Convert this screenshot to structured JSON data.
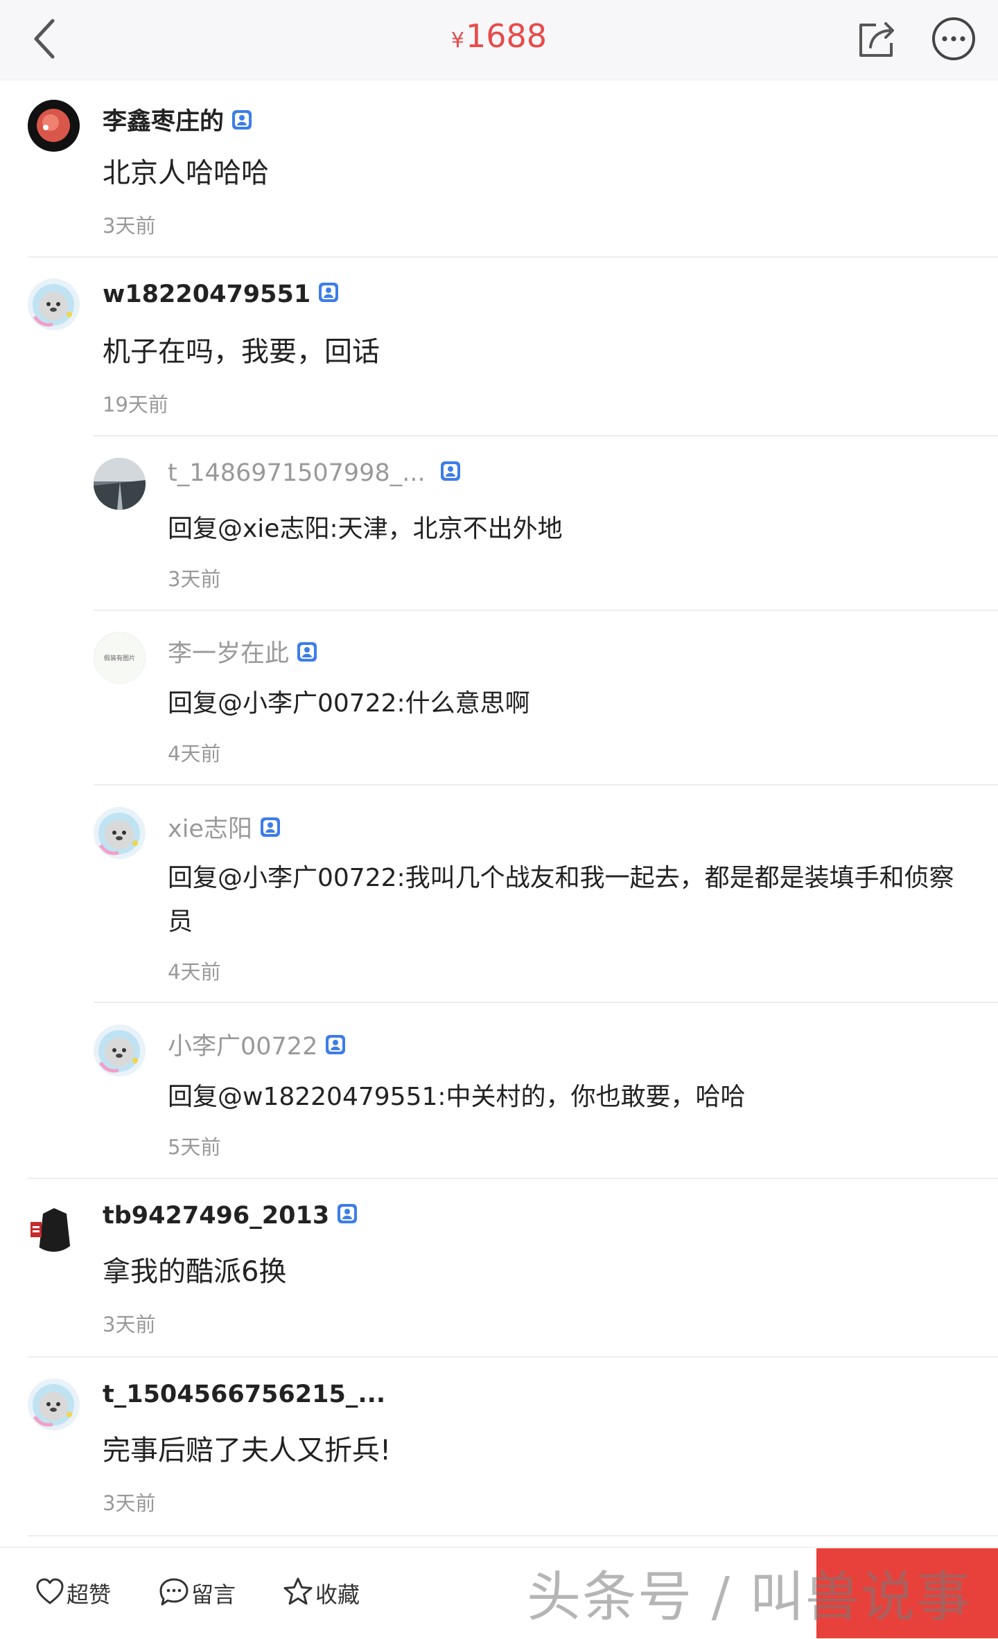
{
  "header": {
    "price_symbol": "¥",
    "price_value": "1688"
  },
  "comments": [
    {
      "user": "李鑫枣庄的",
      "text": "北京人哈哈哈",
      "time": "3天前"
    },
    {
      "user": "w18220479551",
      "text": "机子在吗，我要，回话",
      "time": "19天前"
    },
    {
      "user": "t_1486971507998_...",
      "text": "回复@xie志阳:天津，北京不出外地",
      "time": "3天前"
    },
    {
      "user": "李一岁在此",
      "avatar_text": "假装有图片",
      "text": "回复@小李广00722:什么意思啊",
      "time": "4天前"
    },
    {
      "user": "xie志阳",
      "text_line1": "回复@小李广00722:我叫几个战友和我一起去，都是都是装填手和侦察",
      "text_line2": "员",
      "time": "4天前"
    },
    {
      "user": "小李广00722",
      "text": "回复@w18220479551:中关村的，你也敢要，哈哈",
      "time": "5天前"
    },
    {
      "user": "tb9427496_2013",
      "text": "拿我的酷派6换",
      "time": "3天前"
    },
    {
      "user": "t_1504566756215_...",
      "text": "完事后赔了夫人又折兵!",
      "time": "3天前"
    }
  ],
  "bottom": {
    "like": "超赞",
    "comment": "留言",
    "favorite": "收藏",
    "watermark": "头条号 / 叫兽说事"
  },
  "colors": {
    "accent_red": "#e84a4a",
    "badge_blue": "#3d7de8",
    "bottom_red": "#e8413b"
  }
}
